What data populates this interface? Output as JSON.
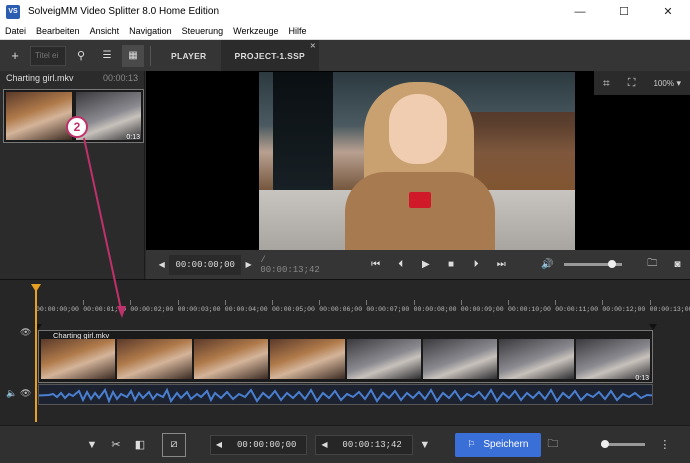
{
  "window": {
    "title": "SolveigMM Video Splitter 8.0 Home Edition",
    "app_icon_text": "VS",
    "minimize_glyph": "—",
    "maximize_glyph": "☐",
    "close_glyph": "✕"
  },
  "menu": [
    "Datei",
    "Bearbeiten",
    "Ansicht",
    "Navigation",
    "Steuerung",
    "Werkzeuge",
    "Hilfe"
  ],
  "toolbar": {
    "add_glyph": "+",
    "search_placeholder": "Titel ei",
    "search_glyph": "⚲",
    "list_glyph": "☰",
    "grid_glyph": "▦",
    "tabs": [
      {
        "label": "PLAYER",
        "active": false
      },
      {
        "label": "PROJECT-1.SSP",
        "active": true,
        "close": "✕"
      }
    ]
  },
  "media_list": {
    "file_name": "Charting girl.mkv",
    "duration": "00:00:13",
    "thumb_duration": "0:13"
  },
  "viewer": {
    "crop_glyph": "⌗",
    "fullscreen_glyph": "⛶",
    "zoom": "100%",
    "zoom_arrow": "▾"
  },
  "transport": {
    "prev_glyph": "◀",
    "next_glyph": "▶",
    "current_time": "00:00:00;00",
    "total_time": "/ 00:00:13;42",
    "buttons": [
      "⏮",
      "⏴",
      "▶",
      "■",
      "⏵",
      "⏭"
    ],
    "volume_glyph": "🔊",
    "volume_level": 0.85,
    "folder_glyph": "🗀",
    "snapshot_glyph": "◙"
  },
  "timeline": {
    "ticks": [
      "00:00:00;00",
      "00:00:01;00",
      "00:00:02;00",
      "00:00:03;00",
      "00:00:04;00",
      "00:00:05;00",
      "00:00:06;00",
      "00:00:07;00",
      "00:00:08;00",
      "00:00:09;00",
      "00:00:10;00",
      "00:00:11;00",
      "00:00:12;00",
      "00:00:13;00"
    ],
    "clip_name": "Charting girl.mkv",
    "clip_duration": "0:13",
    "eye_glyph": "👁",
    "audio_glyph": "🔈",
    "annotation_number": "2"
  },
  "bottombar": {
    "marker_glyph": "▼",
    "cut_glyph": "✂",
    "fragment_glyph": "◧",
    "select_glyph": "⧄",
    "prev_glyph": "◀",
    "next_glyph": "▶",
    "start_time": "00:00:00;00",
    "end_time": "00:00:13;42",
    "end_marker_glyph": "▼",
    "save_label": "Speichern",
    "save_glyph": "⚐",
    "folder_glyph": "🗀",
    "more_glyph": "⋮",
    "zoom_level": 0
  },
  "colors": {
    "accent": "#3a6fd8",
    "playhead": "#e8a020",
    "annotation": "#c0306a",
    "waveform": "#4a7fd0"
  }
}
